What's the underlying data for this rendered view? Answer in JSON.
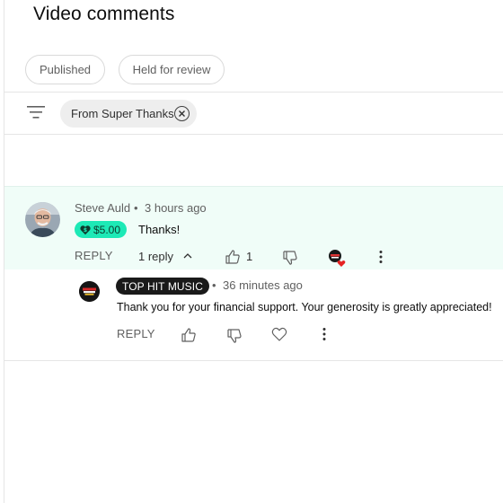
{
  "page": {
    "title": "Video comments"
  },
  "tabs": [
    {
      "label": "Published"
    },
    {
      "label": "Held for review"
    }
  ],
  "filter": {
    "chip_label": "From Super Thanks"
  },
  "comment": {
    "author": "Steve Auld",
    "separator": "•",
    "time": "3 hours ago",
    "superthanks_amount": "$5.00",
    "text": "Thanks!",
    "reply_label": "REPLY",
    "reply_count": "1 reply",
    "like_count": "1"
  },
  "reply": {
    "channel": "TOP HIT MUSIC",
    "separator": "•",
    "time": "36 minutes ago",
    "text": "Thank you for your financial support. Your generosity is greatly appreciated!",
    "reply_label": "REPLY"
  },
  "colors": {
    "superthanks_badge": "#1de9b6",
    "comment_highlight": "#f0fdf8",
    "heart": "#e52222"
  }
}
